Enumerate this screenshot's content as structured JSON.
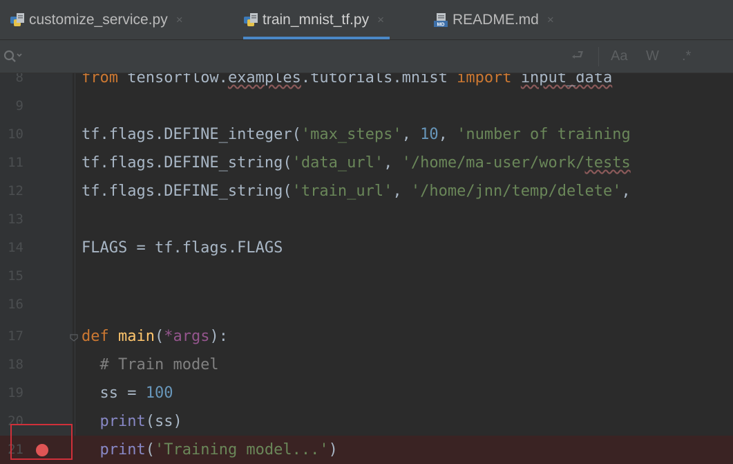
{
  "tabs": [
    {
      "label": "customize_service.py",
      "icon": "python-file-icon",
      "active": false
    },
    {
      "label": "train_mnist_tf.py",
      "icon": "python-file-icon",
      "active": true
    },
    {
      "label": "README.md",
      "icon": "markdown-file-icon",
      "active": false
    }
  ],
  "tab_close_glyph": "×",
  "search": {
    "options": {
      "wrap": "⮐",
      "match_case": "Aa",
      "whole_words": "W",
      "regex": ".*"
    }
  },
  "editor": {
    "lines": [
      {
        "number": "8",
        "code": "from tensorflow.examples.tutorials.mnist import input_data"
      },
      {
        "number": "9",
        "code": ""
      },
      {
        "number": "10",
        "code": "tf.flags.DEFINE_integer('max_steps', 10, 'number of training"
      },
      {
        "number": "11",
        "code": "tf.flags.DEFINE_string('data_url', '/home/ma-user/work/tests"
      },
      {
        "number": "12",
        "code": "tf.flags.DEFINE_string('train_url', '/home/jnn/temp/delete',"
      },
      {
        "number": "13",
        "code": ""
      },
      {
        "number": "14",
        "code": "FLAGS = tf.flags.FLAGS"
      },
      {
        "number": "15",
        "code": ""
      },
      {
        "number": "16",
        "code": ""
      },
      {
        "number": "17",
        "code": "def main(*args):"
      },
      {
        "number": "18",
        "code": "  # Train model"
      },
      {
        "number": "19",
        "code": "  ss = 100"
      },
      {
        "number": "20",
        "code": "  print(ss)"
      },
      {
        "number": "21",
        "code": "  print('Training model...')",
        "breakpoint": true
      }
    ]
  },
  "colors": {
    "keyword": "#cc7832",
    "string": "#6a8759",
    "number": "#6897bb",
    "comment": "#808080",
    "function": "#ffc66d",
    "builtin": "#8888c6",
    "breakpoint": "#e05555",
    "highlight_box": "#d0303a",
    "active_tab_underline": "#4a88c7"
  }
}
